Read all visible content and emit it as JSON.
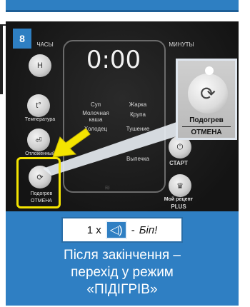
{
  "step": "8",
  "display": {
    "time": "0:00"
  },
  "left_controls": {
    "clock_label": "ЧАСЫ",
    "clock_key": "Н",
    "temp_key": "t°",
    "temp_label": "Температура",
    "delay_label": "Отложенный",
    "reheat_label": "Подогрев",
    "cancel_label": "ОТМЕНА"
  },
  "right_controls": {
    "minutes_label": "МИНУТЫ",
    "start_label": "СТАРТ",
    "recipe_label": "Мой рецепт",
    "plus_label": "PLUS"
  },
  "modes": [
    {
      "left": "Суп",
      "right": "Жарка"
    },
    {
      "left": "Молочная\nкаша",
      "right": "Крупа"
    },
    {
      "left": "Холодец",
      "right": "Тушение"
    },
    {
      "left": "",
      "right": ""
    },
    {
      "left": "Выпечка",
      "right": ""
    }
  ],
  "zoom": {
    "label_top": "Подогрев",
    "label_bottom": "ОТМЕНА"
  },
  "beep": {
    "count": "1 x",
    "separator": "-",
    "text": "Біп!"
  },
  "info": {
    "line1": "Після закінчення –",
    "line2": "перехід у режим",
    "line3": "«ПІДІГРІВ»"
  },
  "colors": {
    "accent": "#2f7fc3",
    "highlight": "#f4e400",
    "panel": "#1e1e1e"
  }
}
